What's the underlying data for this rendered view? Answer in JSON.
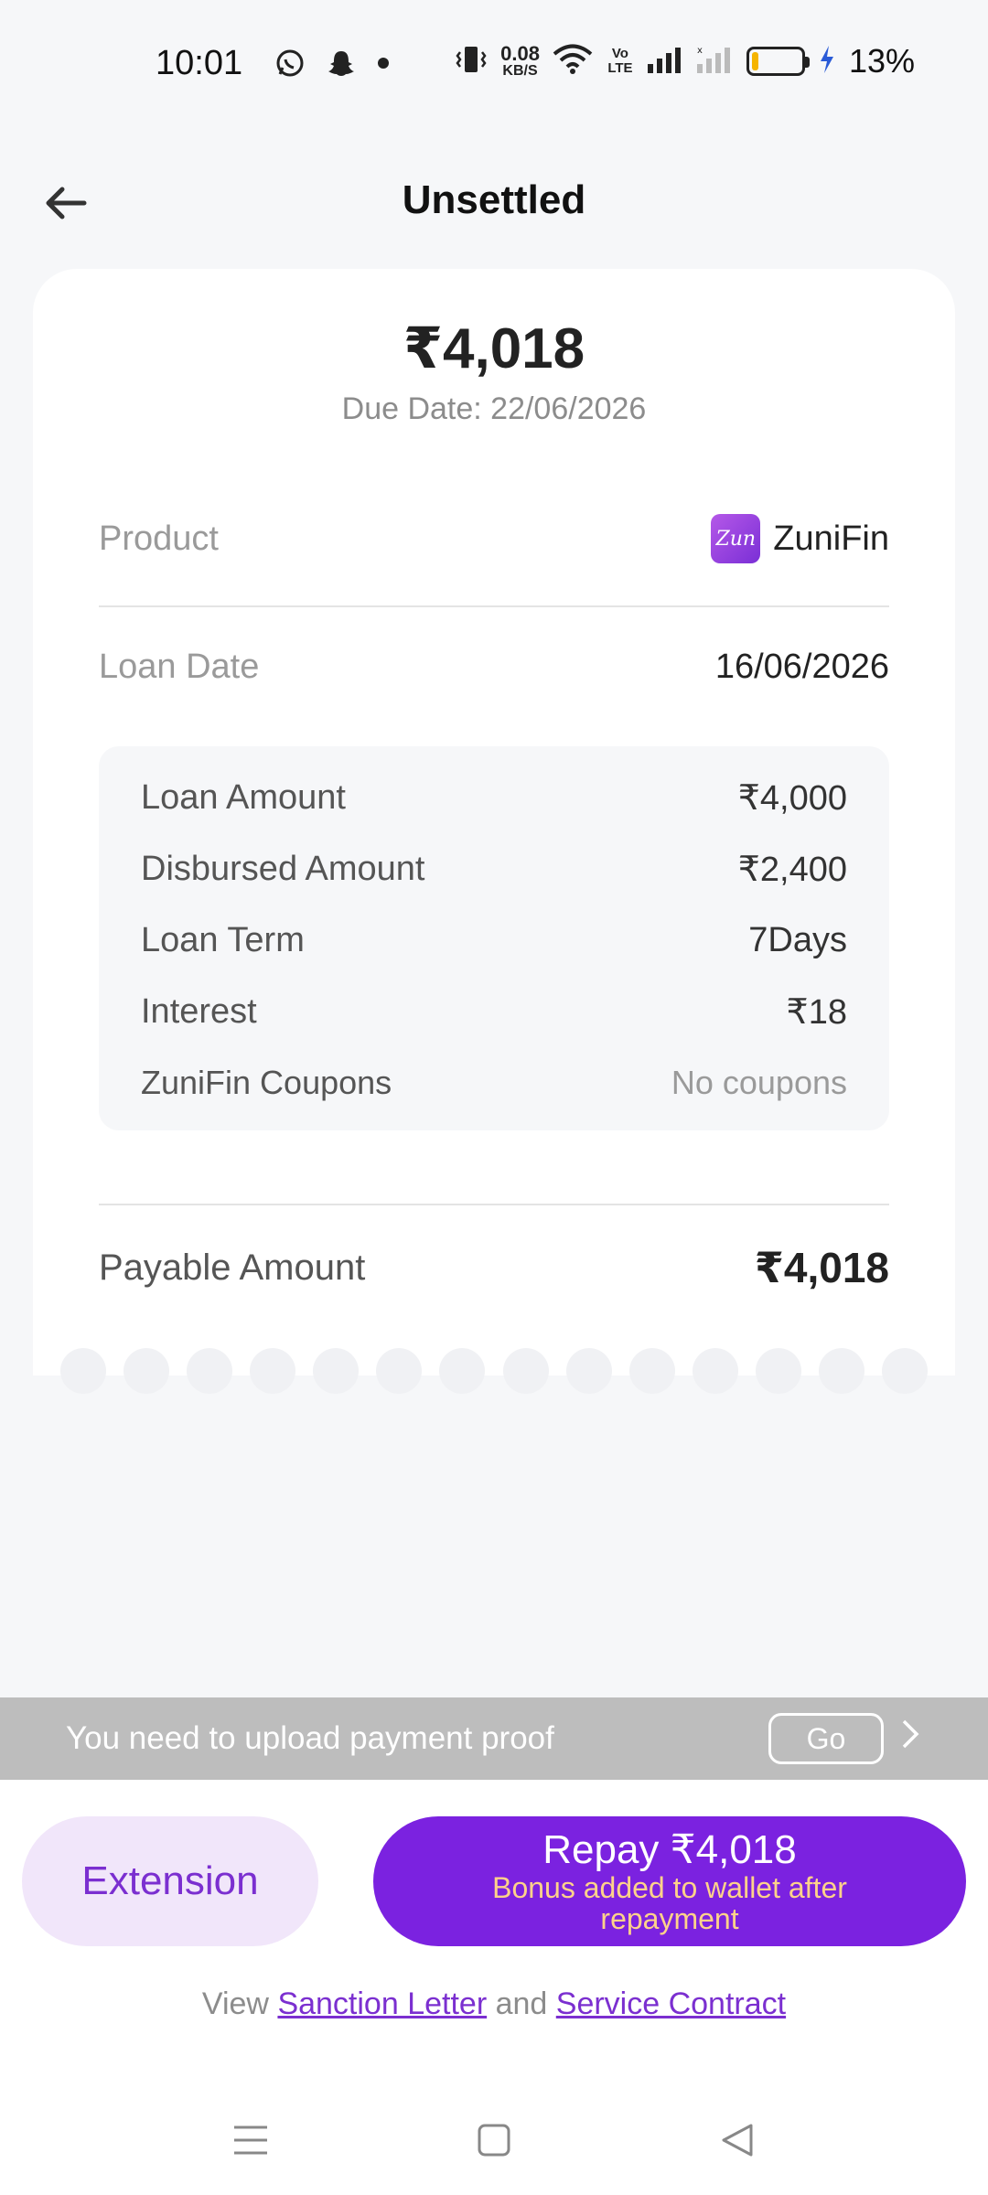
{
  "status_bar": {
    "time": "10:01",
    "speed_value": "0.08",
    "speed_unit": "KB/S",
    "volte": "Vo LTE",
    "battery_pct": "13%",
    "battery_level": 0.13,
    "icons": [
      "whatsapp-icon",
      "snapchat-icon",
      "dot-icon",
      "vibrate-icon",
      "wifi-icon",
      "signal-icon",
      "signal-empty-icon",
      "charging-icon"
    ]
  },
  "header": {
    "title": "Unsettled"
  },
  "loan": {
    "amount": "₹4,018",
    "due_date": "Due Date: 22/06/2026",
    "product_label": "Product",
    "product_logo_text": "Zun",
    "product_name": "ZuniFin",
    "loan_date_label": "Loan Date",
    "loan_date_value": "16/06/2026",
    "details": [
      {
        "label": "Loan Amount",
        "value": "₹4,000"
      },
      {
        "label": "Disbursed Amount",
        "value": "₹2,400"
      },
      {
        "label": "Loan Term",
        "value": "7Days"
      },
      {
        "label": "Interest",
        "value": "₹18"
      },
      {
        "label": "ZuniFin Coupons",
        "value": "No coupons"
      }
    ],
    "payable_label": "Payable Amount",
    "payable_value": "₹4,018"
  },
  "upload_banner": {
    "text": "You need to upload payment proof",
    "go_label": "Go"
  },
  "actions": {
    "extension_label": "Extension",
    "repay_label": "Repay ₹4,018",
    "repay_sub": "Bonus added to wallet after repayment"
  },
  "contract": {
    "prefix": "View ",
    "sanction_link": "Sanction Letter",
    "middle": " and ",
    "service_link": "Service Contract"
  },
  "colors": {
    "accent": "#7b22e0",
    "accent_light": "#f1e6fa",
    "bonus_text": "#ffd28a",
    "banner": "#bdbdbd"
  }
}
